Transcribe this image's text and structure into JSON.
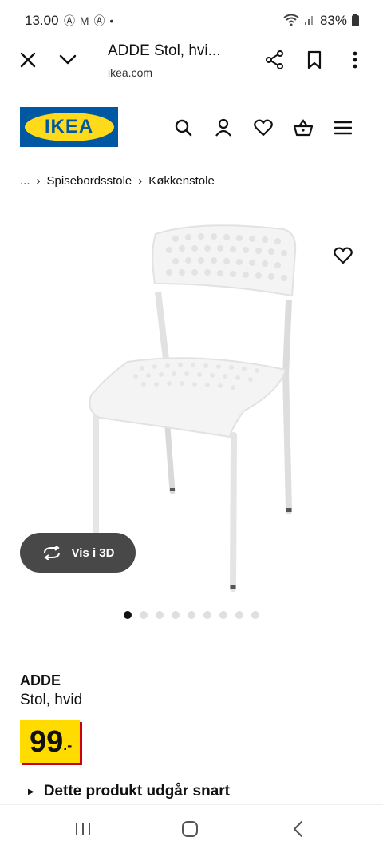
{
  "status_bar": {
    "time": "13.00",
    "left_icons": "Ⓐ M Ⓐ •",
    "battery": "83%"
  },
  "browser": {
    "title": "ADDE Stol, hvi...",
    "url": "ikea.com"
  },
  "header": {
    "logo_text": "IKEA",
    "brand_blue": "#0058a3",
    "brand_yellow": "#ffda1a"
  },
  "breadcrumb": {
    "ellipsis": "...",
    "items": [
      "Spisebordsstole",
      "Køkkenstole"
    ]
  },
  "gallery": {
    "view_3d_label": "Vis i 3D",
    "dot_count": 9,
    "active_dot": 0
  },
  "product": {
    "name": "ADDE",
    "description": "Stol, hvid",
    "price_main": "99",
    "price_suffix": ".-",
    "price_color": "#ffdb00",
    "notice": "Dette produkt udgår snart"
  }
}
